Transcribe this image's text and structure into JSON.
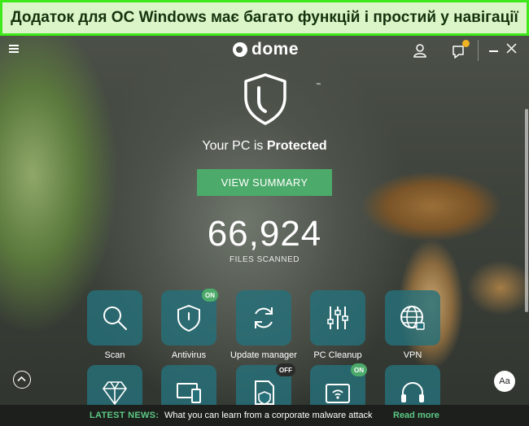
{
  "banner": {
    "text": "Додаток для ОС Windows має багато функцій і простий у навігації"
  },
  "topbar": {
    "logo_text": "dome",
    "icons": [
      "hamburger-menu-icon",
      "user-icon",
      "bell-icon",
      "minimize-icon",
      "close-icon"
    ]
  },
  "status": {
    "prefix": "Your PC is",
    "state": "Protected"
  },
  "summary_button": {
    "label": "VIEW SUMMARY"
  },
  "scan_count": {
    "value": "66,924",
    "label": "FILES SCANNED"
  },
  "tiles_row1": [
    {
      "label": "Scan",
      "icon": "search-icon",
      "badge": ""
    },
    {
      "label": "Antivirus",
      "icon": "shield-icon",
      "badge": "ON"
    },
    {
      "label": "Update manager",
      "icon": "refresh-icon",
      "badge": ""
    },
    {
      "label": "PC Cleanup",
      "icon": "sliders-icon",
      "badge": ""
    },
    {
      "label": "VPN",
      "icon": "globe-lock-icon",
      "badge": ""
    }
  ],
  "tiles_row2": [
    {
      "icon": "diamond-icon",
      "badge": ""
    },
    {
      "icon": "devices-icon",
      "badge": ""
    },
    {
      "icon": "document-shield-icon",
      "badge": "OFF"
    },
    {
      "icon": "wifi-router-icon",
      "badge": "ON"
    },
    {
      "icon": "headset-icon",
      "badge": ""
    }
  ],
  "font_button": {
    "label": "Aa"
  },
  "news": {
    "tag": "LATEST NEWS:",
    "text": "What you can learn from a corporate malware attack",
    "link": "Read more"
  },
  "colors": {
    "accent_green": "#4caa6a",
    "tile_teal": "#26707a",
    "banner_border": "#3ee81a",
    "badge_orange": "#f0b323"
  }
}
